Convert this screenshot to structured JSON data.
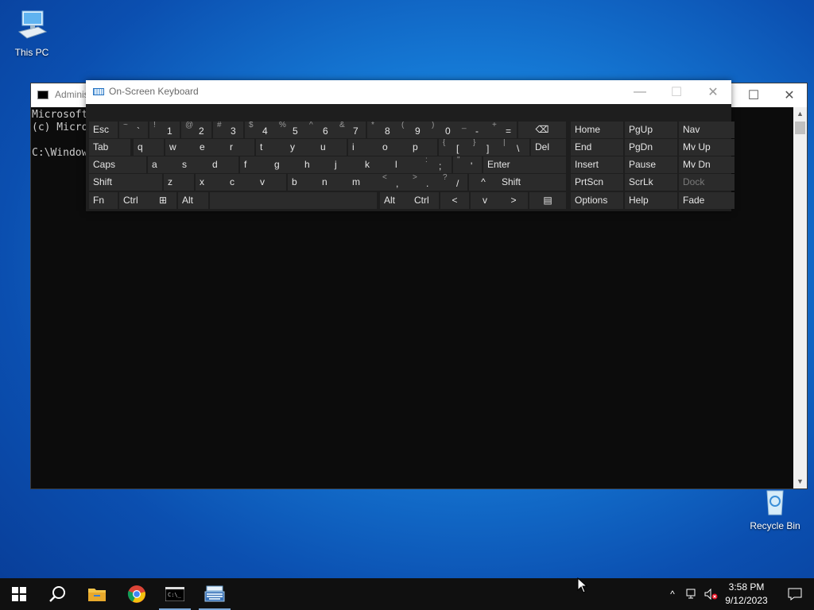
{
  "desktop": {
    "icons": [
      {
        "label": "This PC",
        "icon": "computer-icon"
      },
      {
        "label": "Recycle Bin",
        "icon": "recycle-bin-icon"
      }
    ]
  },
  "cmd_window": {
    "title": "Administrator",
    "lines": [
      "Microsoft",
      "(c) Micro",
      "",
      "C:\\Window"
    ],
    "scroll_up": "▲",
    "scroll_down": "▼",
    "buttons": {
      "minimize": "—",
      "maximize": "☐",
      "close": "✕"
    }
  },
  "osk": {
    "title": "On-Screen Keyboard",
    "buttons": {
      "minimize": "—",
      "maximize": "☐",
      "close": "✕"
    },
    "rows": [
      [
        {
          "label": "Esc"
        },
        {
          "shift": "~",
          "label": "`"
        },
        {
          "shift": "!",
          "label": "1"
        },
        {
          "shift": "@",
          "label": "2"
        },
        {
          "shift": "#",
          "label": "3"
        },
        {
          "shift": "$",
          "label": "4"
        },
        {
          "shift": "%",
          "label": "5"
        },
        {
          "shift": "^",
          "label": "6"
        },
        {
          "shift": "&",
          "label": "7"
        },
        {
          "shift": "*",
          "label": "8"
        },
        {
          "shift": "(",
          "label": "9"
        },
        {
          "shift": ")",
          "label": "0"
        },
        {
          "shift": "_",
          "label": "-"
        },
        {
          "shift": "+",
          "label": "="
        },
        {
          "label": "⌫"
        },
        {
          "label": "Home"
        },
        {
          "label": "PgUp"
        },
        {
          "label": "Nav"
        }
      ],
      [
        {
          "label": "Tab"
        },
        {
          "label": "q"
        },
        {
          "label": "w"
        },
        {
          "label": "e"
        },
        {
          "label": "r"
        },
        {
          "label": "t"
        },
        {
          "label": "y"
        },
        {
          "label": "u"
        },
        {
          "label": "i"
        },
        {
          "label": "o"
        },
        {
          "label": "p"
        },
        {
          "shift": "{",
          "label": "["
        },
        {
          "shift": "}",
          "label": "]"
        },
        {
          "shift": "|",
          "label": "\\"
        },
        {
          "label": "Del"
        },
        {
          "label": "End"
        },
        {
          "label": "PgDn"
        },
        {
          "label": "Mv Up"
        }
      ],
      [
        {
          "label": "Caps"
        },
        {
          "label": "a"
        },
        {
          "label": "s"
        },
        {
          "label": "d"
        },
        {
          "label": "f"
        },
        {
          "label": "g"
        },
        {
          "label": "h"
        },
        {
          "label": "j"
        },
        {
          "label": "k"
        },
        {
          "label": "l"
        },
        {
          "shift": ":",
          "label": ";"
        },
        {
          "shift": "\"",
          "label": "'"
        },
        {
          "label": "Enter"
        },
        {
          "label": "Insert"
        },
        {
          "label": "Pause"
        },
        {
          "label": "Mv Dn"
        }
      ],
      [
        {
          "label": "Shift"
        },
        {
          "label": "z"
        },
        {
          "label": "x"
        },
        {
          "label": "c"
        },
        {
          "label": "v"
        },
        {
          "label": "b"
        },
        {
          "label": "n"
        },
        {
          "label": "m"
        },
        {
          "shift": "<",
          "label": ","
        },
        {
          "shift": ">",
          "label": "."
        },
        {
          "shift": "?",
          "label": "/"
        },
        {
          "label": "^"
        },
        {
          "label": "Shift"
        },
        {
          "label": "PrtScn"
        },
        {
          "label": "ScrLk"
        },
        {
          "label": "Dock"
        }
      ],
      [
        {
          "label": "Fn"
        },
        {
          "label": "Ctrl"
        },
        {
          "label": "⊞"
        },
        {
          "label": "Alt"
        },
        {
          "label": ""
        },
        {
          "label": "Alt"
        },
        {
          "label": "Ctrl"
        },
        {
          "label": "<"
        },
        {
          "label": "v"
        },
        {
          "label": ">"
        },
        {
          "label": "▤"
        },
        {
          "label": "Options"
        },
        {
          "label": "Help"
        },
        {
          "label": "Fade"
        }
      ]
    ]
  },
  "taskbar": {
    "items": [
      {
        "name": "start-button",
        "icon": "windows-logo-icon"
      },
      {
        "name": "search-button",
        "icon": "search-icon"
      },
      {
        "name": "file-explorer-button",
        "icon": "folder-icon"
      },
      {
        "name": "chrome-button",
        "icon": "chrome-icon"
      },
      {
        "name": "cmd-button",
        "icon": "cmd-icon"
      },
      {
        "name": "osk-button",
        "icon": "keyboard-icon"
      }
    ],
    "tray": {
      "chevron": "^",
      "time": "3:58 PM",
      "date": "9/12/2023"
    }
  },
  "colors": {
    "taskbar": "#101010",
    "key": "#2b2b2b",
    "osk_bg": "#1e1e1e",
    "console_bg": "#0c0c0c"
  }
}
